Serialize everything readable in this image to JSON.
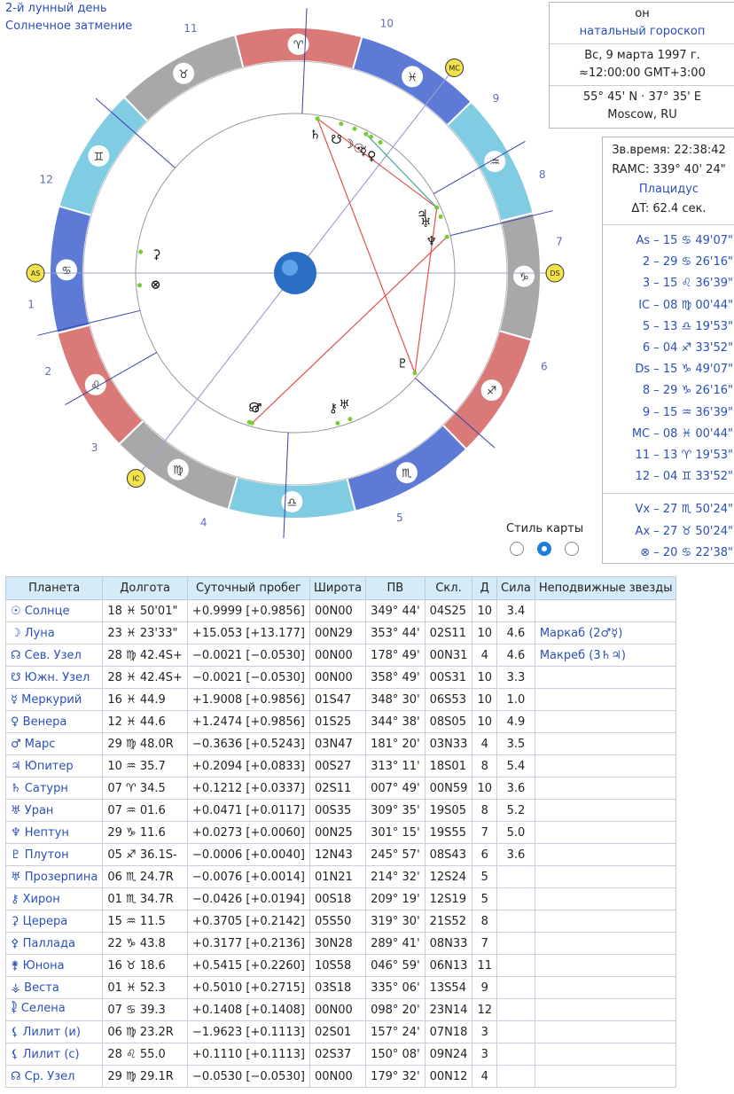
{
  "top_left": {
    "lunar_day": "2-й лунный день",
    "eclipse": "Солнечное затмение"
  },
  "info": {
    "person": "он",
    "chart_type": "натальный гороскоп",
    "date": "Вс, 9 марта 1997 г.",
    "time": "≈12:00:00 GMT+3:00",
    "coords": "55° 45' N · 37° 35' E",
    "place": "Moscow, RU"
  },
  "sidereal": {
    "sid_time": "Зв.время: 22:38:42",
    "ramc": "RAMC: 339° 40' 24\"",
    "house_system": "Плацидус",
    "delta_t": "ΔT: 62.4 сек."
  },
  "cusps": [
    "As  –  15 ♋ 49'07\"",
    "2  –  29 ♋ 26'16\"",
    "3  –  15 ♌ 36'39\"",
    "IC  –  08 ♍ 00'44\"",
    "5  –  13 ♎ 19'53\"",
    "6  –  04 ♐ 33'52\"",
    "Ds  –  15 ♑ 49'07\"",
    "8  –  29 ♑ 26'16\"",
    "9  –  15 ♒ 36'39\"",
    "MC  –  08 ♓ 00'44\"",
    "11  –  13 ♈ 19'53\"",
    "12  –  04 ♊ 33'52\""
  ],
  "extra_points": [
    "Vx  –  27 ♏ 50'24\"",
    "Ax  –  27 ♉ 50'24\"",
    "⊗  –  20 ♋ 22'38\""
  ],
  "chart_style": {
    "label": "Стиль карты",
    "selected": 1
  },
  "chart": {
    "signs": [
      "♈",
      "♉",
      "♊",
      "♋",
      "♌",
      "♍",
      "♎",
      "♏",
      "♐",
      "♑",
      "♒",
      "♓"
    ],
    "house_numbers": [
      "1",
      "2",
      "3",
      "4",
      "5",
      "6",
      "7",
      "8",
      "9",
      "10",
      "11",
      "12"
    ],
    "angle_labels": {
      "as": "AS",
      "ds": "DS",
      "mc": "MC",
      "ic": "IC"
    },
    "planet_glyphs": [
      "♄",
      "☋",
      "☉",
      "☽",
      "☿",
      "♀",
      "♃",
      "♅",
      "♆",
      "♇",
      "⊗",
      "⚳",
      "☊",
      "♂",
      "⚷",
      "♅"
    ],
    "ring_colors": {
      "fire": "#d97a78",
      "earth": "#a8a8a8",
      "air": "#80cde3",
      "water": "#5d7ad6"
    }
  },
  "table": {
    "headers": [
      "Планета",
      "Долгота",
      "Суточный пробег",
      "Широта",
      "ПВ",
      "Скл.",
      "Д",
      "Сила",
      "Неподвижные звезды"
    ],
    "rows": [
      [
        "☉ Солнце",
        "18 ♓ 50'01\"",
        "+0.9999 [+0.9856]",
        "00N00",
        "349° 44'",
        "04S25",
        "10",
        "3.4",
        ""
      ],
      [
        "☽ Луна",
        "23 ♓ 23'33\"",
        "+15.053 [+13.177]",
        "00N29",
        "353° 44'",
        "02S11",
        "10",
        "4.6",
        "Маркаб (2♂☿)"
      ],
      [
        "☊ Сев. Узел",
        "28 ♍ 42.4S+",
        "−0.0021 [−0.0530]",
        "00N00",
        "178° 49'",
        "00N31",
        "4",
        "4.6",
        "Макреб (3♄♃)"
      ],
      [
        "☋ Южн. Узел",
        "28 ♓ 42.4S+",
        "−0.0021 [−0.0530]",
        "00N00",
        "358° 49'",
        "00S31",
        "10",
        "3.3",
        ""
      ],
      [
        "☿ Меркурий",
        "16 ♓ 44.9",
        "+1.9008 [+0.9856]",
        "01S47",
        "348° 30'",
        "06S53",
        "10",
        "1.0",
        ""
      ],
      [
        "♀ Венера",
        "12 ♓ 44.6",
        "+1.2474 [+0.9856]",
        "01S25",
        "344° 38'",
        "08S05",
        "10",
        "4.9",
        ""
      ],
      [
        "♂ Марс",
        "29 ♍ 48.0R",
        "−0.3636 [+0.5243]",
        "03N47",
        "181° 20'",
        "03N33",
        "4",
        "3.5",
        ""
      ],
      [
        "♃ Юпитер",
        "10 ♒ 35.7",
        "+0.2094 [+0.0833]",
        "00S27",
        "313° 11'",
        "18S01",
        "8",
        "5.4",
        ""
      ],
      [
        "♄ Сатурн",
        "07 ♈ 34.5",
        "+0.1212 [+0.0337]",
        "02S11",
        "007° 49'",
        "00N59",
        "10",
        "3.6",
        ""
      ],
      [
        "♅ Уран",
        "07 ♒ 01.6",
        "+0.0471 [+0.0117]",
        "00S35",
        "309° 35'",
        "19S05",
        "8",
        "5.2",
        ""
      ],
      [
        "♆ Нептун",
        "29 ♑ 11.6",
        "+0.0273 [+0.0060]",
        "00N25",
        "301° 15'",
        "19S55",
        "7",
        "5.0",
        ""
      ],
      [
        "♇ Плутон",
        "05 ♐ 36.1S-",
        "−0.0006 [+0.0040]",
        "12N43",
        "245° 57'",
        "08S43",
        "6",
        "3.6",
        ""
      ],
      [
        "♅ Прозерпина",
        "06 ♏ 24.7R",
        "−0.0076 [+0.0014]",
        "01N21",
        "214° 32'",
        "12S24",
        "5",
        "",
        ""
      ],
      [
        "⚷ Хирон",
        "01 ♏ 34.7R",
        "−0.0426 [+0.0194]",
        "00S18",
        "209° 19'",
        "12S19",
        "5",
        "",
        ""
      ],
      [
        "⚳ Церера",
        "15 ♒ 11.5",
        "+0.3705 [+0.2142]",
        "05S50",
        "319° 30'",
        "21S52",
        "8",
        "",
        ""
      ],
      [
        "⚴ Паллада",
        "22 ♑ 43.8",
        "+0.3177 [+0.2136]",
        "30N28",
        "289° 41'",
        "08N33",
        "7",
        "",
        ""
      ],
      [
        "⚵ Юнона",
        "16 ♉ 18.6",
        "+0.5415 [+0.2260]",
        "10S58",
        "046° 59'",
        "06N13",
        "11",
        "",
        ""
      ],
      [
        "⚶ Веста",
        "01 ♓ 52.3",
        "+0.5010 [+0.2715]",
        "03S18",
        "335° 06'",
        "13S54",
        "9",
        "",
        ""
      ],
      [
        "⯝ Селена",
        "07 ♋ 39.3",
        "+0.1408 [+0.1408]",
        "00N00",
        "098° 20'",
        "23N14",
        "12",
        "",
        ""
      ],
      [
        "⚸ Лилит (и)",
        "06 ♍ 23.2R",
        "−1.9623 [+0.1113]",
        "02S01",
        "157° 24'",
        "07N18",
        "3",
        "",
        ""
      ],
      [
        "⚸ Лилит (с)",
        "28 ♌ 55.0",
        "+0.1110 [+0.1113]",
        "02S37",
        "150° 08'",
        "09N24",
        "3",
        "",
        ""
      ],
      [
        "☊ Ср. Узел",
        "29 ♍ 29.1R",
        "−0.0530 [−0.0530]",
        "00N00",
        "179° 32'",
        "00N12",
        "4",
        "",
        ""
      ]
    ]
  }
}
